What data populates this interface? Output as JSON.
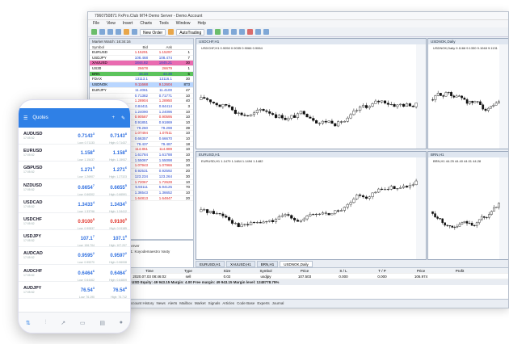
{
  "desktop": {
    "title": "7960750871 FxPro.Club MT4 Demo Server - Demo Account",
    "menu": [
      "File",
      "View",
      "Insert",
      "Charts",
      "Tools",
      "Window",
      "Help"
    ],
    "toolbar": {
      "new_order": "New Order",
      "autotrading": "AutoTrading"
    },
    "market_watch": {
      "header": "Market Watch: 16:34:16",
      "cols": [
        "Symbol",
        "Bid",
        "Ask",
        ""
      ],
      "rows": [
        [
          "EURUSD",
          "1.15291",
          "1.15297",
          "1"
        ],
        [
          "USDJPY",
          "108.468",
          "108.474",
          "7"
        ],
        [
          "XAUUSD",
          "1844.82",
          "1845.21",
          "30"
        ],
        [
          "US30",
          "26678",
          "26679",
          "1"
        ],
        [
          "BRN",
          "44.34",
          "44.39",
          "5"
        ],
        [
          "FDAX",
          "13113.1",
          "13116.1",
          "30"
        ],
        [
          "USDNOK",
          "9.11668",
          "9.12604",
          "873"
        ],
        [
          "EURJPY",
          "11.4061",
          "11.4100",
          "47"
        ],
        [
          "",
          "0.71382",
          "0.71771",
          "10"
        ],
        [
          "",
          "1.28904",
          "1.28950",
          "40"
        ],
        [
          "",
          "0.84411",
          "0.84414",
          "3"
        ],
        [
          "",
          "1.24090",
          "1.24096",
          "10"
        ],
        [
          "",
          "0.90587",
          "0.90595",
          "10"
        ],
        [
          "",
          "0.91851",
          "0.91869",
          "10"
        ],
        [
          "",
          "79.260",
          "79.298",
          "39"
        ],
        [
          "",
          "1.07494",
          "1.07511",
          "10"
        ],
        [
          "",
          "0.66357",
          "0.66670",
          "10"
        ],
        [
          "",
          "79.437",
          "79.487",
          "18"
        ],
        [
          "",
          "114.851",
          "114.889",
          "10"
        ],
        [
          "",
          "1.61784",
          "1.61788",
          "10"
        ],
        [
          "",
          "1.55087",
          "1.55098",
          "20"
        ],
        [
          "",
          "1.07943",
          "1.07966",
          "10"
        ],
        [
          "",
          "0.92531",
          "0.92592",
          "20"
        ],
        [
          "",
          "123.234",
          "123.264",
          "30"
        ],
        [
          "",
          "1.72067",
          "1.72628",
          "10"
        ],
        [
          "",
          "5.93111",
          "5.94125",
          "70"
        ],
        [
          "",
          "1.36543",
          "1.36652",
          "10"
        ],
        [
          "",
          "1.64813",
          "1.64847",
          "20"
        ]
      ]
    },
    "navigator": [
      "FX Demo Server",
      "7960750871: Koyodemaestro Vasty"
    ],
    "charts": [
      {
        "header": "USDCHF,H1",
        "info": "USDCHF,H1 0.9050 0.9035 0.9066 0.9064"
      },
      {
        "header": "USDNOK,Daily",
        "info": "USDNOK,Daily 9.1166 9.1330 9.1048 9.1131"
      },
      {
        "header": "EURUSD,H1",
        "info": "EURUSD,H1 1.1479 1.1484 1.1494 1.1482"
      },
      {
        "header": "BRN,H1",
        "info": "BRN,H1 44.25 44.40 44.01 44.28"
      }
    ],
    "chart_tabs": [
      "EURUSD,H1",
      "XAUUSD,H1",
      "BRN,H1",
      "USDNOK,Daily"
    ],
    "terminal": {
      "cols": [
        "Time",
        "Type",
        "Size",
        "Symbol",
        "Price",
        "S / L",
        "T / P",
        "Price",
        "Profit"
      ],
      "row": [
        "2020.07.03 08:46:02",
        "sell",
        "0.02",
        "usdjpy",
        "107.503",
        "0.000",
        "0.000",
        "106.974",
        ""
      ],
      "account": "USD Equity: 49 943.15  Margin: 4.00  Free margin: 49 943.15  Margin level: 1248778.75%",
      "tabs": [
        "Account History",
        "News",
        "Alerts",
        "Mailbox",
        "Market",
        "Signals",
        "Articles",
        "Code Base",
        "Experts",
        "Journal"
      ]
    }
  },
  "mobile": {
    "title": "Quotes",
    "quotes": [
      {
        "sym": "AUDUSD",
        "sub": "17:05:52",
        "bid": "0.7143",
        "bid_s": "3",
        "ask": "0.7143",
        "ask_s": "8",
        "lo": "Low: 0.71133",
        "hi": "High: 0.71437",
        "bid_col": "blue",
        "ask_col": "blue"
      },
      {
        "sym": "EURUSD",
        "sub": "17:05:52",
        "bid": "1.158",
        "bid_s": "8",
        "ask": "1.158",
        "ask_s": "8",
        "lo": "Low: 1.15437",
        "hi": "High: 1.15937",
        "bid_col": "blue",
        "ask_col": "blue"
      },
      {
        "sym": "GBPUSD",
        "sub": "17:05:52",
        "bid": "1.271",
        "bid_s": "5",
        "ask": "1.271",
        "ask_s": "6",
        "lo": "Low: 1.26907",
        "hi": "High: 1.27323",
        "bid_col": "blue",
        "ask_col": "blue"
      },
      {
        "sym": "NZDUSD",
        "sub": "17:05:52",
        "bid": "0.6654",
        "bid_s": "7",
        "ask": "0.6655",
        "ask_s": "5",
        "lo": "Low: 0.66302",
        "hi": "High: 0.66591",
        "bid_col": "blue",
        "ask_col": "blue"
      },
      {
        "sym": "USDCAD",
        "sub": "17:05:52",
        "bid": "1.3433",
        "bid_s": "4",
        "ask": "1.3434",
        "ask_s": "1",
        "lo": "Low: 1.33796",
        "hi": "High: 1.34412",
        "bid_col": "blue",
        "ask_col": "blue"
      },
      {
        "sym": "USDCHF",
        "sub": "17:05:52",
        "bid": "0.9100",
        "bid_s": "5",
        "ask": "0.9100",
        "ask_s": "5",
        "lo": "Low: 0.90837",
        "hi": "High: 0.91185",
        "bid_col": "red",
        "ask_col": "red"
      },
      {
        "sym": "USDJPY",
        "sub": "17:05:52",
        "bid": "107.1",
        "bid_s": "7",
        "ask": "107.1",
        "ask_s": "8",
        "lo": "Low: 106.704",
        "hi": "High: 107.207",
        "bid_col": "blue",
        "ask_col": "blue"
      },
      {
        "sym": "AUDCAD",
        "sub": "17:05:52",
        "bid": "0.9595",
        "bid_s": "2",
        "ask": "0.9597",
        "ask_s": "2",
        "lo": "Low: 0.95370",
        "hi": "High: 0.96008",
        "bid_col": "blue",
        "ask_col": "blue"
      },
      {
        "sym": "AUDCHF",
        "sub": "17:05:52",
        "bid": "0.6464",
        "bid_s": "6",
        "ask": "0.6464",
        "ask_s": "7",
        "lo": "Low: 0.64462",
        "hi": "High: 0.64809",
        "bid_col": "blue",
        "ask_col": "blue"
      },
      {
        "sym": "AUDJPY",
        "sub": "17:05:52",
        "bid": "76.54",
        "bid_s": "3",
        "ask": "76.54",
        "ask_s": "8",
        "lo": "Low: 76.190",
        "hi": "High: 76.712",
        "bid_col": "blue",
        "ask_col": "blue"
      }
    ],
    "nav": [
      "quotes-icon",
      "chart-icon",
      "trade-icon",
      "history-icon",
      "news-icon",
      "chat-icon"
    ],
    "accent": "#2f80e6"
  }
}
